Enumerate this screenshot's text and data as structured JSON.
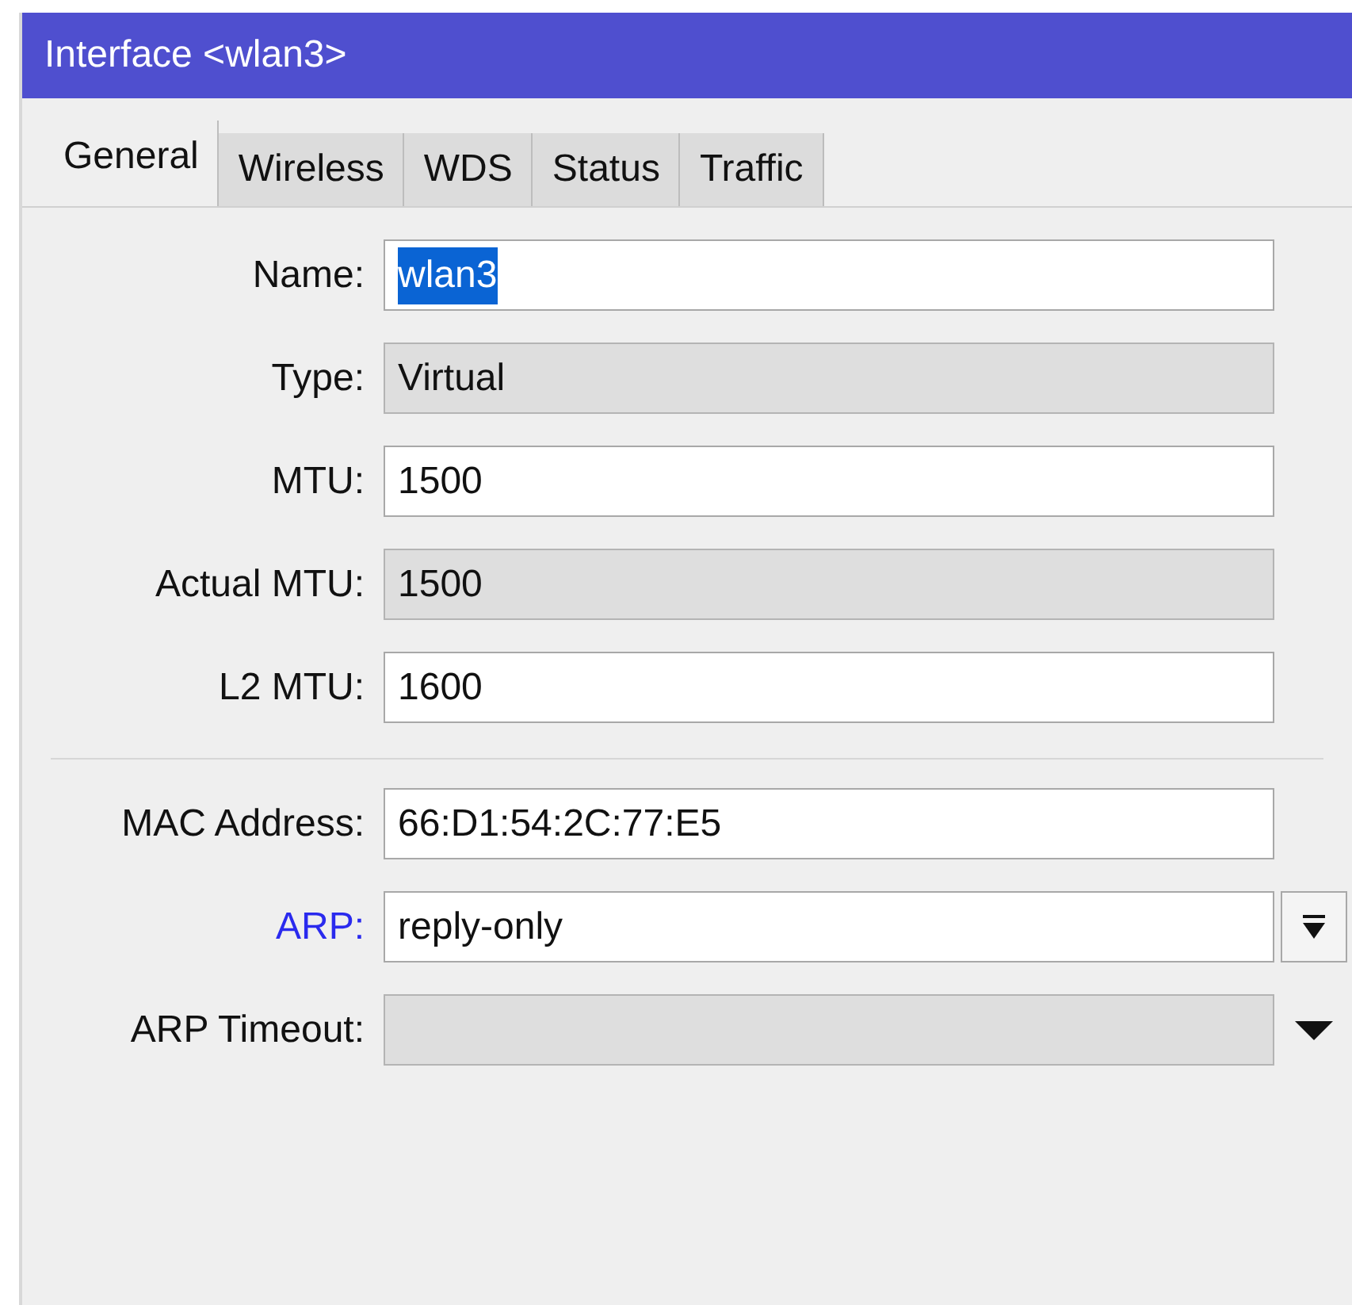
{
  "window": {
    "title": "Interface <wlan3>"
  },
  "tabs": [
    {
      "label": "General",
      "selected": true
    },
    {
      "label": "Wireless",
      "selected": false
    },
    {
      "label": "WDS",
      "selected": false
    },
    {
      "label": "Status",
      "selected": false
    },
    {
      "label": "Traffic",
      "selected": false
    }
  ],
  "field_groups": [
    [
      {
        "label": "Name:",
        "value": "wlan3",
        "editable": true,
        "value_selected": true
      },
      {
        "label": "Type:",
        "value": "Virtual",
        "editable": false
      },
      {
        "label": "MTU:",
        "value": "1500",
        "editable": true
      },
      {
        "label": "Actual MTU:",
        "value": "1500",
        "editable": false
      },
      {
        "label": "L2 MTU:",
        "value": "1600",
        "editable": true
      }
    ],
    [
      {
        "label": "MAC Address:",
        "value": "66:D1:54:2C:77:E5",
        "editable": true
      },
      {
        "label": "ARP:",
        "value": "reply-only",
        "editable": true,
        "label_link": true,
        "kind": "combo"
      },
      {
        "label": "ARP Timeout:",
        "editable": false,
        "kind": "dropdown"
      }
    ]
  ]
}
